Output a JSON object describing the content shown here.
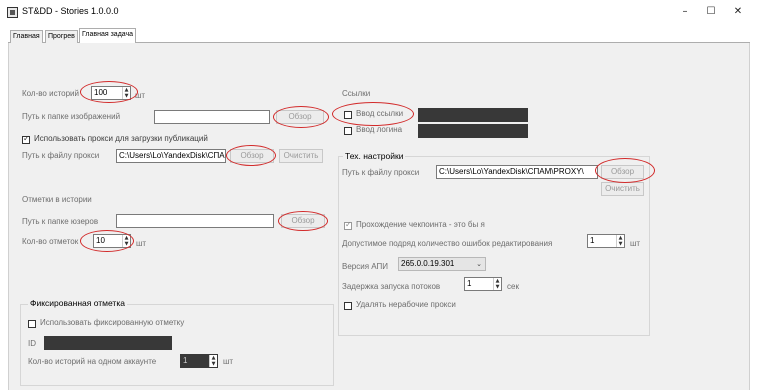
{
  "window": {
    "title": "ST&DD - Stories 1.0.0.0",
    "minimize": "–",
    "maximize": "☐",
    "close": "✕"
  },
  "tabs": [
    "Главная",
    "Прогрев",
    "Главная задача"
  ],
  "left": {
    "stories_count_label": "Кол-во историй",
    "stories_count_value": "100",
    "stories_count_unit": "шт",
    "images_folder_label": "Путь к папке изображений",
    "images_folder_value": "",
    "browse_label": "Обзор",
    "use_proxy_label": "Использовать прокси для загрузки публикаций",
    "proxy_file_label": "Путь к файлу прокси",
    "proxy_file_value": "C:\\Users\\Lo\\YandexDisk\\СПАМ",
    "clear_label": "Очистить",
    "mentions_section": "Отметки в истории",
    "users_folder_label": "Путь к папке юзеров",
    "users_folder_value": "",
    "mentions_count_label": "Кол-во отметок",
    "mentions_count_value": "10",
    "mentions_count_unit": "шт"
  },
  "fixed": {
    "title": "Фиксированная отметка",
    "use_fixed_label": "Использовать фиксированную отметку",
    "id_label": "ID",
    "stories_per_account_label": "Кол-во историй на одном аккаунте",
    "stories_per_account_value": "1",
    "stories_per_account_unit": "шт"
  },
  "links": {
    "title": "Ссылки",
    "link_input_label": "Ввод ссылки",
    "login_input_label": "Ввод логина"
  },
  "tech": {
    "title": "Тех. настройки",
    "proxy_file_label": "Путь к файлу прокси",
    "proxy_file_value": "C:\\Users\\Lo\\YandexDisk\\СПАМ\\PROXY\\",
    "browse_label": "Обзор",
    "clear_label": "Очистить",
    "checkpoint_label": "Прохождение чекпоинта - это бы я",
    "edit_errors_label": "Допустимое подряд количество ошибок редактирования",
    "edit_errors_value": "1",
    "edit_errors_unit": "шт",
    "api_version_label": "Версия АПИ",
    "api_version_value": "265.0.0.19.301",
    "thread_delay_label": "Задержка запуска потоков",
    "thread_delay_value": "1",
    "thread_delay_unit": "сек",
    "delete_proxy_label": "Удалять нерабочие прокси"
  }
}
